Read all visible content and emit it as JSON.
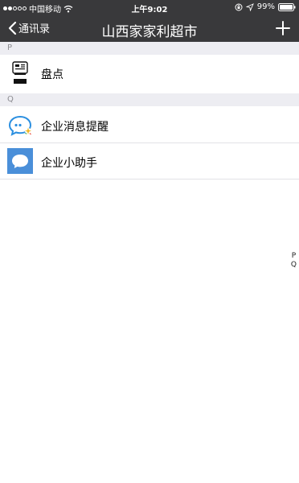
{
  "status_bar": {
    "carrier": "中国移动",
    "time": "上午9:02",
    "battery": "99%"
  },
  "nav": {
    "back_label": "通讯录",
    "title": "山西家家利超市"
  },
  "sections": [
    {
      "letter": "P",
      "items": [
        {
          "label": "盘点",
          "icon": "inventory-device-icon"
        }
      ]
    },
    {
      "letter": "Q",
      "items": [
        {
          "label": "企业消息提醒",
          "icon": "chat-bubble-reminder-icon"
        },
        {
          "label": "企业小助手",
          "icon": "chat-bubble-assistant-icon"
        }
      ]
    }
  ],
  "index": [
    "P",
    "Q"
  ],
  "colors": {
    "bar": "#39393b",
    "section_bg": "#ededf2",
    "section_text": "#8d8d92",
    "assistant_blue": "#4a8fd9"
  }
}
